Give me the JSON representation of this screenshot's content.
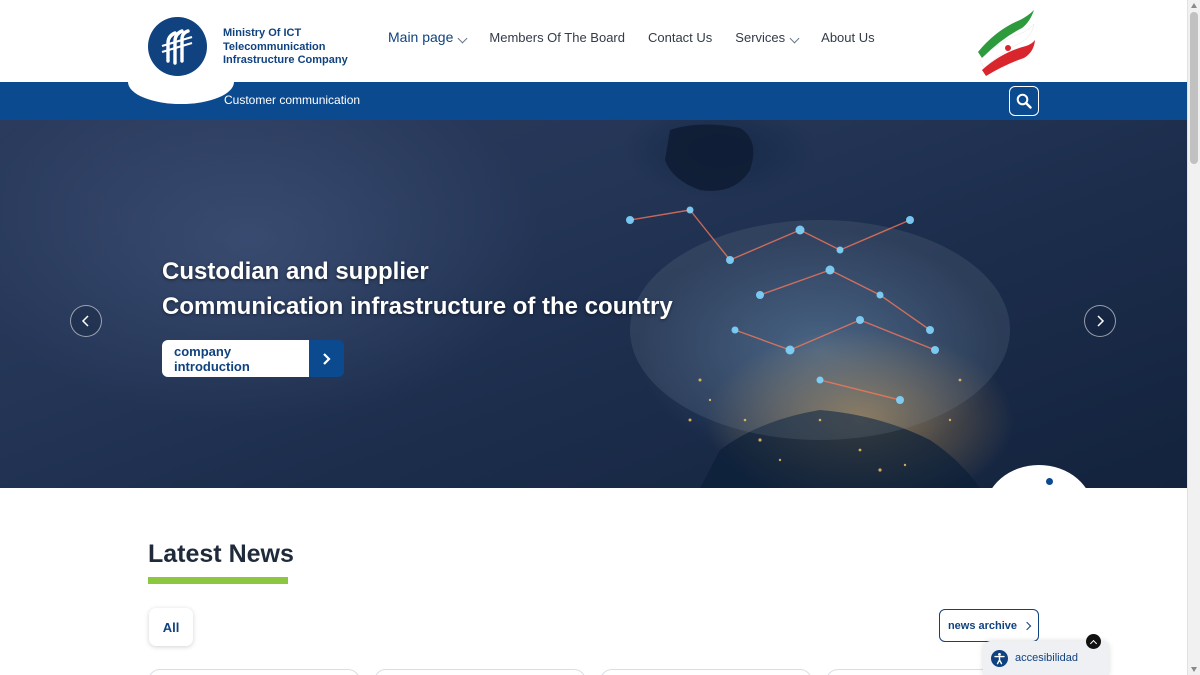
{
  "header": {
    "logo_lines": [
      "Ministry Of ICT",
      "Telecommunication",
      "Infrastructure Company"
    ],
    "nav": [
      {
        "label": "Main page",
        "icon": "chevron-down-icon"
      },
      {
        "label": "Members Of The Board"
      },
      {
        "label": "Contact Us"
      },
      {
        "label": "Services",
        "icon": "chevron-down-icon"
      },
      {
        "label": "About Us"
      }
    ],
    "flag_icon": "iran-flag-icon"
  },
  "subbar": {
    "link": "Customer communication",
    "search_icon": "search-icon"
  },
  "hero": {
    "title_lines": [
      "Custodian and supplier",
      "Communication infrastructure of the country"
    ],
    "button_label": "company introduction",
    "prev_icon": "chevron-left-icon",
    "next_icon": "chevron-right-icon"
  },
  "news": {
    "title": "Latest News",
    "filter_all": "All",
    "archive_label": "news archive"
  },
  "accessibility": {
    "label": "accesibilidad",
    "icon": "accessibility-icon"
  },
  "colors": {
    "brand_blue": "#10427f",
    "bar_blue": "#0c4a8f",
    "accent_green": "#8dc63f"
  }
}
